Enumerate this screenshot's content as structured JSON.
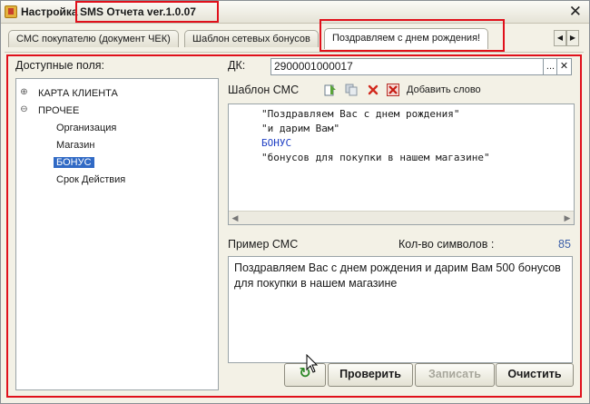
{
  "window": {
    "title_prefix": "Настройка",
    "title_suffix": "SMS Отчета ver.1.0.07",
    "close_glyph": "✕"
  },
  "tabs": [
    {
      "label": "СМС покупателю (документ ЧЕК)",
      "active": false
    },
    {
      "label": "Шаблон сетевых бонусов",
      "active": false
    },
    {
      "label": "Поздравляем с днем рождения!",
      "active": true
    }
  ],
  "fields_panel": {
    "label": "Доступные поля:",
    "tree": [
      {
        "label": "КАРТА КЛИЕНТА",
        "toggle": "⊕",
        "level": 0
      },
      {
        "label": "ПРОЧЕЕ",
        "toggle": "⊖",
        "level": 0
      },
      {
        "label": "Организация",
        "level": 1
      },
      {
        "label": "Магазин",
        "level": 1
      },
      {
        "label": "БОНУС",
        "level": 1,
        "selected": true
      },
      {
        "label": "Срок Действия",
        "level": 1
      }
    ]
  },
  "dk": {
    "label": "ДК:",
    "value": "2900001000017",
    "select_glyph": "...",
    "clear_glyph": "✕"
  },
  "template": {
    "label": "Шаблон СМС",
    "add_word_label": "Добавить слово",
    "lines": [
      {
        "text": "\"Поздравляем Вас с днем рождения\"",
        "color": "#1a1a1a"
      },
      {
        "text": "\"и дарим Вам\"",
        "color": "#1a1a1a"
      },
      {
        "text": "БОНУС",
        "color": "#1f3fc4"
      },
      {
        "text": "\"бонусов для покупки в нашем магазине\"",
        "color": "#1a1a1a"
      }
    ]
  },
  "example": {
    "label": "Пример СМС",
    "count_label": "Кол-во символов :",
    "count_value": "85",
    "text": "Поздравляем Вас с днем рождения и дарим Вам  500 бонусов для покупки в нашем магазине"
  },
  "buttons": {
    "refresh_glyph": "↻",
    "check": "Проверить",
    "write": "Записать",
    "clear": "Очистить"
  },
  "colors": {
    "accent_red": "#e0101b",
    "count_blue": "#3c5fa8",
    "selection": "#316ac5"
  }
}
